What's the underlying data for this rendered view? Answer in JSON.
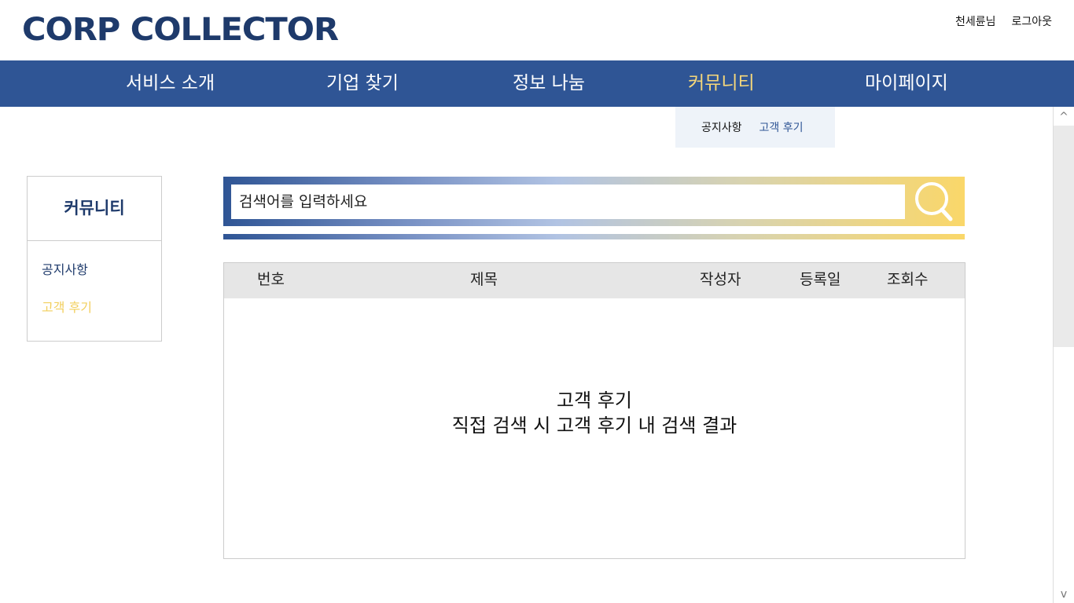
{
  "header": {
    "logo": "CORP COLLECTOR",
    "user_name": "천세륜님",
    "logout": "로그아웃"
  },
  "nav": {
    "items": [
      "서비스 소개",
      "기업 찾기",
      "정보 나눔",
      "커뮤니티",
      "마이페이지"
    ],
    "active": "커뮤니티"
  },
  "submenu": {
    "items": [
      "공지사항",
      "고객 후기"
    ],
    "active": "고객 후기"
  },
  "sidebar": {
    "title": "커뮤니티",
    "items": [
      "공지사항",
      "고객 후기"
    ],
    "active": "고객 후기"
  },
  "search": {
    "placeholder": "검색어를 입력하세요",
    "icon": "search-icon"
  },
  "table": {
    "columns": [
      "번호",
      "제목",
      "작성자",
      "등록일",
      "조회수"
    ],
    "body_line1": "고객 후기",
    "body_line2": "직접 검색 시 고객 후기 내 검색 결과"
  },
  "colors": {
    "brand": "#2f5595",
    "accent": "#f7d87a",
    "logo": "#1e3a6b"
  }
}
